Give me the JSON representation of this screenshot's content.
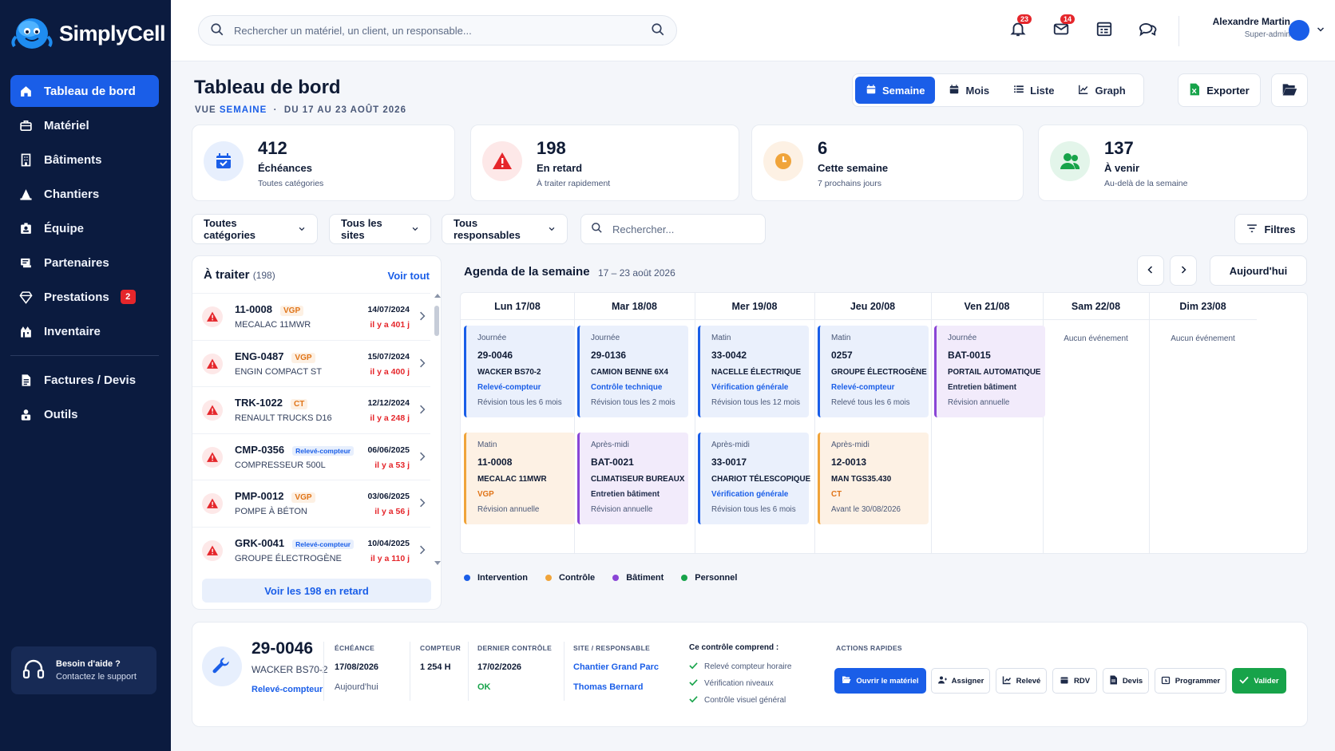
{
  "brand": {
    "name": "SimplyCell"
  },
  "sidebar": {
    "items": [
      {
        "label": "Tableau de bord",
        "icon": "home-icon",
        "active": true
      },
      {
        "label": "Matériel",
        "icon": "toolbox-icon"
      },
      {
        "label": "Bâtiments",
        "icon": "building-icon"
      },
      {
        "label": "Chantiers",
        "icon": "construction-icon"
      },
      {
        "label": "Équipe",
        "icon": "badge-icon"
      },
      {
        "label": "Partenaires",
        "icon": "handshake-icon"
      },
      {
        "label": "Prestations",
        "icon": "diamond-icon",
        "badge": "2"
      },
      {
        "label": "Inventaire",
        "icon": "inventory-icon"
      }
    ],
    "items2": [
      {
        "label": "Factures / Devis",
        "icon": "invoice-icon"
      },
      {
        "label": "Outils",
        "icon": "tools-icon"
      }
    ],
    "help": {
      "title": "Besoin d'aide ?",
      "subtitle": "Contactez le support"
    }
  },
  "topbar": {
    "search_placeholder": "Rechercher un matériel, un client, un responsable...",
    "notifications_badge": "23",
    "messages_badge": "14",
    "user": {
      "name": "Alexandre Martin",
      "role": "Super-admin"
    }
  },
  "header": {
    "title": "Tableau de bord",
    "view_label": "VUE",
    "view_value": "SEMAINE",
    "range": "DU 17 AU 23 AOÛT 2026",
    "views": [
      "Semaine",
      "Mois",
      "Liste",
      "Graph"
    ],
    "export_label": "Exporter"
  },
  "stats": [
    {
      "value": "412",
      "label": "Échéances",
      "sub": "Toutes catégories",
      "color": "#1a5ee8"
    },
    {
      "value": "198",
      "label": "En retard",
      "sub": "À traiter rapidement",
      "color": "#e5262b"
    },
    {
      "value": "6",
      "label": "Cette semaine",
      "sub": "7 prochains jours",
      "color": "#f0a43a"
    },
    {
      "value": "137",
      "label": "À venir",
      "sub": "Au-delà de la semaine",
      "color": "#17a34a"
    }
  ],
  "filters": {
    "categories": "Toutes catégories",
    "sites": "Tous les sites",
    "responsables": "Tous responsables",
    "search_placeholder": "Rechercher...",
    "filters_label": "Filtres"
  },
  "todo": {
    "title": "À traiter",
    "count": "(198)",
    "see_all": "Voir tout",
    "button": "Voir les 198 en retard",
    "items": [
      {
        "code": "11-0008",
        "tag": "VGP",
        "tag_type": "vgp",
        "name": "MECALAC 11MWR",
        "date": "14/07/2024",
        "late": "il y a 401 j"
      },
      {
        "code": "ENG-0487",
        "tag": "VGP",
        "tag_type": "vgp",
        "name": "ENGIN COMPACT ST",
        "date": "15/07/2024",
        "late": "il y a 400 j"
      },
      {
        "code": "TRK-1022",
        "tag": "CT",
        "tag_type": "ct",
        "name": "RENAULT TRUCKS D16",
        "date": "12/12/2024",
        "late": "il y a 248 j"
      },
      {
        "code": "CMP-0356",
        "tag": "Relevé-compteur",
        "tag_type": "rel",
        "name": "COMPRESSEUR 500L",
        "date": "06/06/2025",
        "late": "il y a 53 j"
      },
      {
        "code": "PMP-0012",
        "tag": "VGP",
        "tag_type": "vgp",
        "name": "POMPE À BÉTON",
        "date": "03/06/2025",
        "late": "il y a 56 j"
      },
      {
        "code": "GRK-0041",
        "tag": "Relevé-compteur",
        "tag_type": "rel",
        "name": "GROUPE ÉLECTROGÈNE",
        "date": "10/04/2025",
        "late": "il y a 110 j"
      }
    ]
  },
  "agenda": {
    "title": "Agenda de la semaine",
    "range": "17 – 23 août 2026",
    "today_label": "Aujourd'hui",
    "days": [
      "Lun 17/08",
      "Mar 18/08",
      "Mer 19/08",
      "Jeu 20/08",
      "Ven 21/08",
      "Sam 22/08",
      "Dim 23/08"
    ],
    "no_event": "Aucun événement",
    "events": [
      {
        "day": 0,
        "row": 0,
        "color": "blue",
        "when": "Journée",
        "code": "29-0046",
        "name": "WACKER BS70-2",
        "type": "Relevé-compteur",
        "type_color": "blue",
        "freq": "Révision tous les 6 mois"
      },
      {
        "day": 1,
        "row": 0,
        "color": "blue",
        "when": "Journée",
        "code": "29-0136",
        "name": "CAMION BENNE 6X4",
        "type": "Contrôle technique",
        "type_color": "blue",
        "freq": "Révision tous les 2 mois"
      },
      {
        "day": 2,
        "row": 0,
        "color": "blue",
        "when": "Matin",
        "code": "33-0042",
        "name": "NACELLE ÉLECTRIQUE",
        "type": "Vérification générale",
        "type_color": "blue",
        "freq": "Révision tous les 12 mois"
      },
      {
        "day": 3,
        "row": 0,
        "color": "blue",
        "when": "Matin",
        "code": "0257",
        "name": "GROUPE ÉLECTROGÈNE",
        "type": "Relevé-compteur",
        "type_color": "blue",
        "freq": "Relevé tous les 6 mois"
      },
      {
        "day": 4,
        "row": 0,
        "color": "purple",
        "when": "Journée",
        "code": "BAT-0015",
        "name": "PORTAIL AUTOMATIQUE",
        "type": "Entretien bâtiment",
        "type_color": "dark",
        "freq": "Révision annuelle"
      },
      {
        "day": 0,
        "row": 1,
        "color": "orange",
        "when": "Matin",
        "code": "11-0008",
        "name": "MECALAC 11MWR",
        "type": "VGP",
        "type_color": "orange",
        "freq": "Révision annuelle"
      },
      {
        "day": 1,
        "row": 1,
        "color": "purple",
        "when": "Après-midi",
        "code": "BAT-0021",
        "name": "CLIMATISEUR BUREAUX",
        "type": "Entretien bâtiment",
        "type_color": "dark",
        "freq": "Révision annuelle"
      },
      {
        "day": 2,
        "row": 1,
        "color": "blue",
        "when": "Après-midi",
        "code": "33-0017",
        "name": "CHARIOT TÉLESCOPIQUE",
        "type": "Vérification générale",
        "type_color": "blue",
        "freq": "Révision tous les 6 mois"
      },
      {
        "day": 3,
        "row": 1,
        "color": "orange",
        "when": "Après-midi",
        "code": "12-0013",
        "name": "MAN TGS35.430",
        "type": "CT",
        "type_color": "orange",
        "freq": "Avant le 30/08/2026"
      }
    ],
    "legend": [
      {
        "label": "Intervention",
        "color": "#1a5ee8"
      },
      {
        "label": "Contrôle",
        "color": "#f0a43a"
      },
      {
        "label": "Bâtiment",
        "color": "#8a45d6"
      },
      {
        "label": "Personnel",
        "color": "#17a34a"
      }
    ]
  },
  "detail": {
    "code": "29-0046",
    "name": "WACKER BS70-2",
    "type": "Relevé-compteur",
    "echeance_label": "ÉCHÉANCE",
    "echeance": "17/08/2026",
    "echeance_sub": "Aujourd'hui",
    "compteur_label": "COMPTEUR",
    "compteur": "1 254 H",
    "dernier_label": "DERNIER CONTRÔLE",
    "dernier": "17/02/2026",
    "dernier_status": "OK",
    "site_label": "SITE / RESPONSABLE",
    "site": "Chantier Grand Parc",
    "responsable": "Thomas Bernard",
    "checklist_title": "Ce contrôle comprend :",
    "checklist": [
      "Relevé compteur horaire",
      "Vérification niveaux",
      "Contrôle visuel général"
    ],
    "actions_label": "ACTIONS RAPIDES",
    "actions": [
      "Ouvrir le matériel",
      "Assigner",
      "Relevé",
      "RDV",
      "Devis",
      "Programmer",
      "Valider"
    ]
  }
}
